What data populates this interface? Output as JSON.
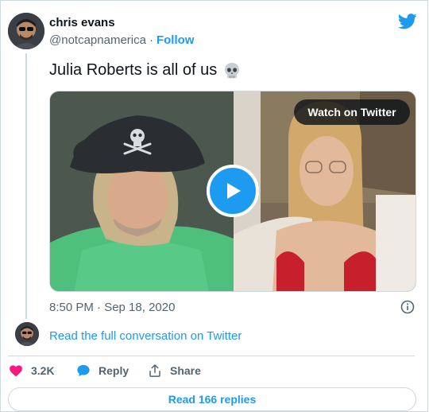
{
  "author": {
    "display_name": "chris evans",
    "handle": "@notcapnamerica",
    "separator": "·",
    "follow_label": "Follow"
  },
  "tweet": {
    "text": "Julia Roberts is all of us",
    "emoji_icon": "skull-emoji-icon",
    "timestamp": "8:50 PM · Sep 18, 2020"
  },
  "media": {
    "watch_label": "Watch on Twitter",
    "play_icon": "play-icon"
  },
  "conversation": {
    "link_text": "Read the full conversation on Twitter"
  },
  "actions": {
    "likes": "3.2K",
    "reply_label": "Reply",
    "share_label": "Share"
  },
  "footer": {
    "read_replies_label": "Read 166 replies"
  },
  "colors": {
    "accent": "#1d9bf0",
    "like": "#f91880",
    "muted": "#536471",
    "text": "#0f1419",
    "border": "#cfd9de"
  }
}
